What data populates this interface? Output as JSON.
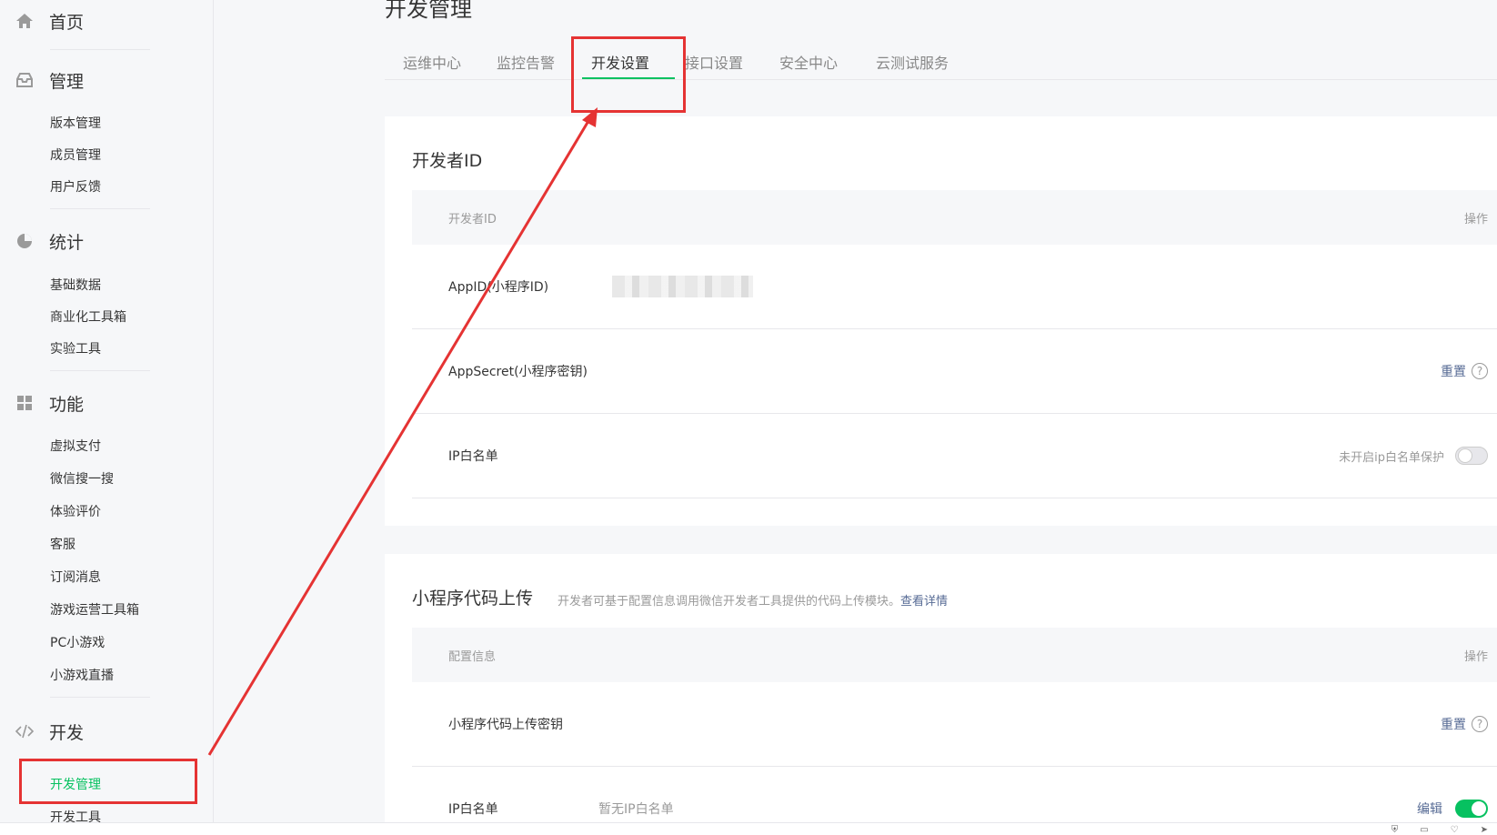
{
  "sidebar": {
    "home": "首页",
    "manage": {
      "title": "管理",
      "items": [
        "版本管理",
        "成员管理",
        "用户反馈"
      ]
    },
    "stats": {
      "title": "统计",
      "items": [
        "基础数据",
        "商业化工具箱",
        "实验工具"
      ]
    },
    "features": {
      "title": "功能",
      "items": [
        "虚拟支付",
        "微信搜一搜",
        "体验评价",
        "客服",
        "订阅消息",
        "游戏运营工具箱",
        "PC小游戏",
        "小游戏直播"
      ]
    },
    "dev": {
      "title": "开发",
      "items": [
        "开发管理",
        "开发工具"
      ],
      "active_index": 0
    }
  },
  "main": {
    "page_title": "开发管理",
    "tabs": [
      "运维中心",
      "监控告警",
      "开发设置",
      "接口设置",
      "安全中心",
      "云测试服务"
    ],
    "active_tab": "开发设置",
    "dev_id_card": {
      "title": "开发者ID",
      "col_name": "开发者ID",
      "col_action": "操作",
      "rows": [
        {
          "label": "AppID(小程序ID)",
          "value": "",
          "action": ""
        },
        {
          "label": "AppSecret(小程序密钥)",
          "value": "",
          "action": "重置"
        },
        {
          "label": "IP白名单",
          "value": "",
          "action": "未开启ip白名单保护"
        }
      ]
    },
    "upload_card": {
      "title": "小程序代码上传",
      "desc": "开发者可基于配置信息调用微信开发者工具提供的代码上传模块。",
      "desc_link": "查看详情",
      "col_name": "配置信息",
      "col_action": "操作",
      "rows": [
        {
          "label": "小程序代码上传密钥",
          "value": "",
          "action": "重置"
        },
        {
          "label": "IP白名单",
          "value": "暂无IP白名单",
          "action": "编辑"
        }
      ]
    }
  },
  "colors": {
    "accent_green": "#07c160",
    "link_blue": "#576b95",
    "annotation_red": "#e53333"
  },
  "icons": {
    "home": "home-icon",
    "manage": "inbox-icon",
    "stats": "pie-chart-icon",
    "features": "grid-icon",
    "dev": "code-icon",
    "help": "question-circle-icon"
  }
}
